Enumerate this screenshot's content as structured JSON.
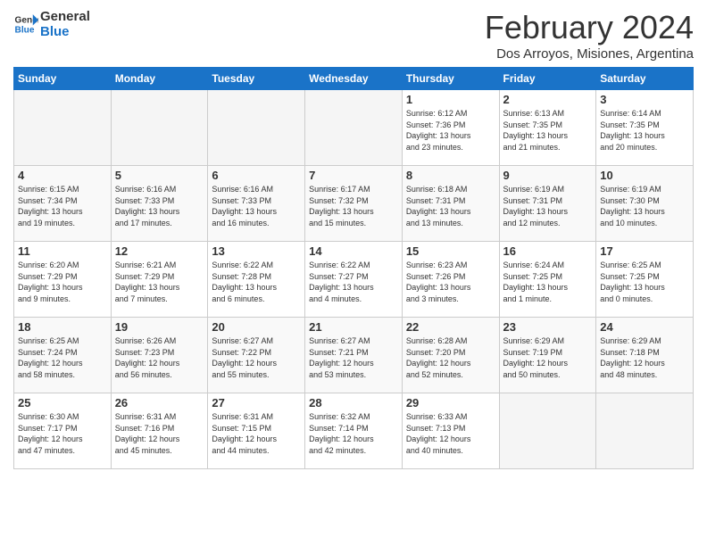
{
  "header": {
    "logo_line1": "General",
    "logo_line2": "Blue",
    "month_title": "February 2024",
    "subtitle": "Dos Arroyos, Misiones, Argentina"
  },
  "days_of_week": [
    "Sunday",
    "Monday",
    "Tuesday",
    "Wednesday",
    "Thursday",
    "Friday",
    "Saturday"
  ],
  "weeks": [
    [
      {
        "day": "",
        "info": ""
      },
      {
        "day": "",
        "info": ""
      },
      {
        "day": "",
        "info": ""
      },
      {
        "day": "",
        "info": ""
      },
      {
        "day": "1",
        "info": "Sunrise: 6:12 AM\nSunset: 7:36 PM\nDaylight: 13 hours\nand 23 minutes."
      },
      {
        "day": "2",
        "info": "Sunrise: 6:13 AM\nSunset: 7:35 PM\nDaylight: 13 hours\nand 21 minutes."
      },
      {
        "day": "3",
        "info": "Sunrise: 6:14 AM\nSunset: 7:35 PM\nDaylight: 13 hours\nand 20 minutes."
      }
    ],
    [
      {
        "day": "4",
        "info": "Sunrise: 6:15 AM\nSunset: 7:34 PM\nDaylight: 13 hours\nand 19 minutes."
      },
      {
        "day": "5",
        "info": "Sunrise: 6:16 AM\nSunset: 7:33 PM\nDaylight: 13 hours\nand 17 minutes."
      },
      {
        "day": "6",
        "info": "Sunrise: 6:16 AM\nSunset: 7:33 PM\nDaylight: 13 hours\nand 16 minutes."
      },
      {
        "day": "7",
        "info": "Sunrise: 6:17 AM\nSunset: 7:32 PM\nDaylight: 13 hours\nand 15 minutes."
      },
      {
        "day": "8",
        "info": "Sunrise: 6:18 AM\nSunset: 7:31 PM\nDaylight: 13 hours\nand 13 minutes."
      },
      {
        "day": "9",
        "info": "Sunrise: 6:19 AM\nSunset: 7:31 PM\nDaylight: 13 hours\nand 12 minutes."
      },
      {
        "day": "10",
        "info": "Sunrise: 6:19 AM\nSunset: 7:30 PM\nDaylight: 13 hours\nand 10 minutes."
      }
    ],
    [
      {
        "day": "11",
        "info": "Sunrise: 6:20 AM\nSunset: 7:29 PM\nDaylight: 13 hours\nand 9 minutes."
      },
      {
        "day": "12",
        "info": "Sunrise: 6:21 AM\nSunset: 7:29 PM\nDaylight: 13 hours\nand 7 minutes."
      },
      {
        "day": "13",
        "info": "Sunrise: 6:22 AM\nSunset: 7:28 PM\nDaylight: 13 hours\nand 6 minutes."
      },
      {
        "day": "14",
        "info": "Sunrise: 6:22 AM\nSunset: 7:27 PM\nDaylight: 13 hours\nand 4 minutes."
      },
      {
        "day": "15",
        "info": "Sunrise: 6:23 AM\nSunset: 7:26 PM\nDaylight: 13 hours\nand 3 minutes."
      },
      {
        "day": "16",
        "info": "Sunrise: 6:24 AM\nSunset: 7:25 PM\nDaylight: 13 hours\nand 1 minute."
      },
      {
        "day": "17",
        "info": "Sunrise: 6:25 AM\nSunset: 7:25 PM\nDaylight: 13 hours\nand 0 minutes."
      }
    ],
    [
      {
        "day": "18",
        "info": "Sunrise: 6:25 AM\nSunset: 7:24 PM\nDaylight: 12 hours\nand 58 minutes."
      },
      {
        "day": "19",
        "info": "Sunrise: 6:26 AM\nSunset: 7:23 PM\nDaylight: 12 hours\nand 56 minutes."
      },
      {
        "day": "20",
        "info": "Sunrise: 6:27 AM\nSunset: 7:22 PM\nDaylight: 12 hours\nand 55 minutes."
      },
      {
        "day": "21",
        "info": "Sunrise: 6:27 AM\nSunset: 7:21 PM\nDaylight: 12 hours\nand 53 minutes."
      },
      {
        "day": "22",
        "info": "Sunrise: 6:28 AM\nSunset: 7:20 PM\nDaylight: 12 hours\nand 52 minutes."
      },
      {
        "day": "23",
        "info": "Sunrise: 6:29 AM\nSunset: 7:19 PM\nDaylight: 12 hours\nand 50 minutes."
      },
      {
        "day": "24",
        "info": "Sunrise: 6:29 AM\nSunset: 7:18 PM\nDaylight: 12 hours\nand 48 minutes."
      }
    ],
    [
      {
        "day": "25",
        "info": "Sunrise: 6:30 AM\nSunset: 7:17 PM\nDaylight: 12 hours\nand 47 minutes."
      },
      {
        "day": "26",
        "info": "Sunrise: 6:31 AM\nSunset: 7:16 PM\nDaylight: 12 hours\nand 45 minutes."
      },
      {
        "day": "27",
        "info": "Sunrise: 6:31 AM\nSunset: 7:15 PM\nDaylight: 12 hours\nand 44 minutes."
      },
      {
        "day": "28",
        "info": "Sunrise: 6:32 AM\nSunset: 7:14 PM\nDaylight: 12 hours\nand 42 minutes."
      },
      {
        "day": "29",
        "info": "Sunrise: 6:33 AM\nSunset: 7:13 PM\nDaylight: 12 hours\nand 40 minutes."
      },
      {
        "day": "",
        "info": ""
      },
      {
        "day": "",
        "info": ""
      }
    ]
  ]
}
